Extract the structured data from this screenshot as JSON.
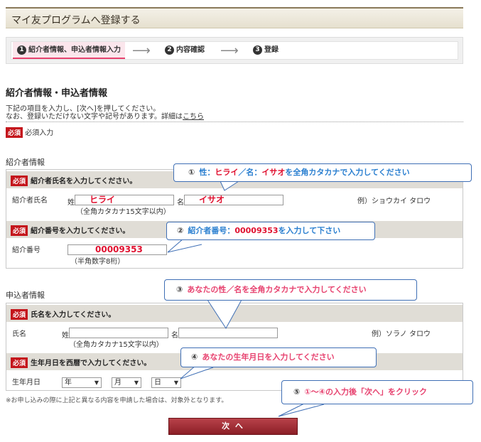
{
  "title": "マイ友プログラムへ登録する",
  "steps": [
    {
      "num": "1",
      "label": "紹介者情報、申込者情報入力"
    },
    {
      "num": "2",
      "label": "内容確認"
    },
    {
      "num": "3",
      "label": "登録"
    }
  ],
  "step_arrow": "⟶",
  "section_heading": "紹介者情報・申込者情報",
  "desc_line1": "下記の項目を入力し、[次へ]を押してください。",
  "desc_line2": "なお、登録いただけない文字や記号があります。詳細は",
  "desc_link": "こちら",
  "required_badge": "必須",
  "required_note": "必須入力",
  "referrer": {
    "section": "紹介者情報",
    "name_prompt": "紹介者氏名を入力してください。",
    "name_label": "紹介者氏名",
    "sei_label": "姓",
    "mei_label": "名",
    "sei_value": "ヒライ",
    "mei_value": "イサオ",
    "name_hint": "（全角カタカナ15文字以内）",
    "name_example": "例）ショウカイ タロウ",
    "number_prompt": "紹介番号を入力してください。",
    "number_label": "紹介番号",
    "number_value": "00009353",
    "number_hint": "（半角数字8桁）"
  },
  "applicant": {
    "section": "申込者情報",
    "name_prompt": "氏名を入力してください。",
    "name_label": "氏名",
    "sei_label": "姓",
    "mei_label": "名",
    "name_hint": "（全角カタカナ15文字以内）",
    "name_example": "例）ソラノ タロウ",
    "dob_prompt": "生年月日を西暦で入力してください。",
    "dob_label": "生年月日",
    "year": "年",
    "month": "月",
    "day": "日"
  },
  "notice": "※お申し込みの際に上記と異なる内容を申請した場合は、対象外となります。",
  "next_button": "次 へ",
  "callouts": {
    "c1": {
      "num": "①",
      "t1": "性：",
      "t2": "ヒライ",
      "t3": "／名：",
      "t4": "イサオ",
      "t5": "を全角カタカナで入力してください"
    },
    "c2": {
      "num": "②",
      "t1": "紹介者番号：",
      "t2": "00009353",
      "t3": "を入力して下さい"
    },
    "c3": {
      "num": "③",
      "text": "あなたの性／名を全角カタカナで入力してください"
    },
    "c4": {
      "num": "④",
      "text": "あなたの生年月日を入力してください"
    },
    "c5": {
      "num": "⑤",
      "t1": "①～④の入力後「",
      "t2": "次へ",
      "t3": "」をクリック"
    }
  }
}
